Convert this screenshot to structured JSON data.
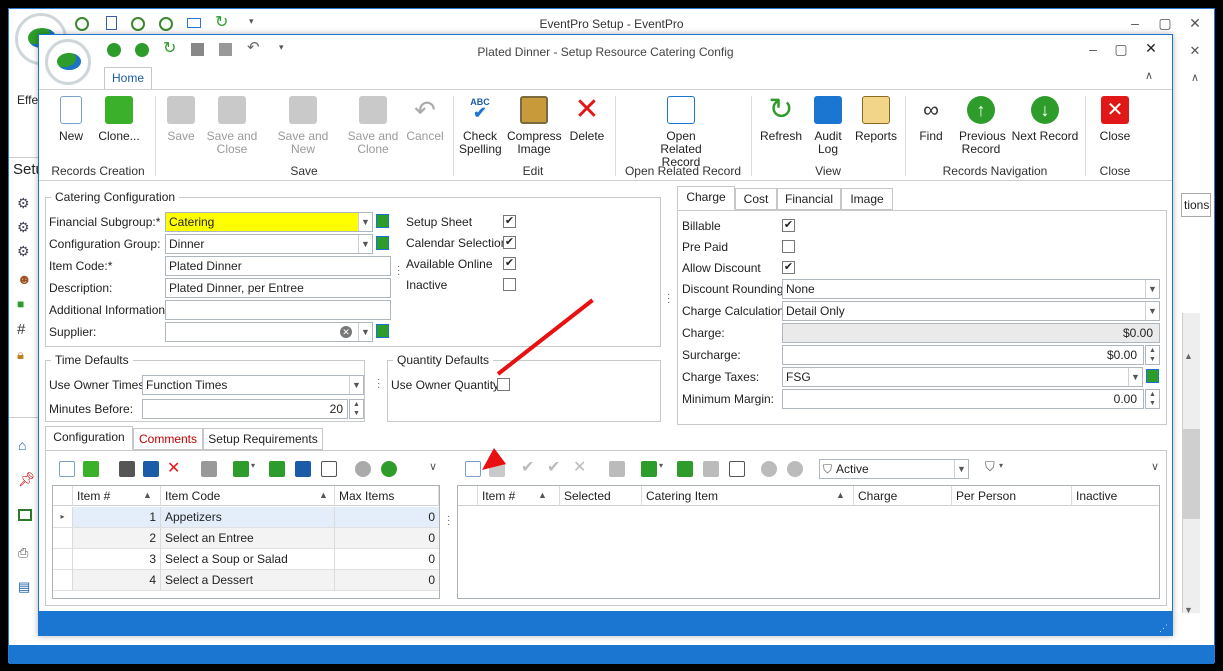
{
  "outer": {
    "title": "EventPro Setup - EventPro",
    "side_labels": [
      "Effe",
      "Setu"
    ],
    "right_tab_label": "tions"
  },
  "window": {
    "title": "Plated Dinner - Setup Resource Catering Config",
    "tab_home": "Home"
  },
  "ribbon": {
    "groups": {
      "records_creation": "Records Creation",
      "save": "Save",
      "edit": "Edit",
      "open_related": "Open Related Record",
      "view": "View",
      "nav": "Records Navigation",
      "close": "Close"
    },
    "buttons": {
      "new": "New",
      "clone": "Clone...",
      "save": "Save",
      "save_close": "Save and Close",
      "save_new": "Save and New",
      "save_clone": "Save and Clone",
      "cancel": "Cancel",
      "check_spelling": "Check Spelling",
      "compress_image": "Compress Image",
      "delete": "Delete",
      "open_related": "Open Related Record",
      "refresh": "Refresh",
      "audit_log": "Audit Log",
      "reports": "Reports",
      "find": "Find",
      "previous_record": "Previous Record",
      "next_record": "Next Record",
      "close": "Close"
    }
  },
  "catering_config": {
    "title": "Catering Configuration",
    "financial_subgroup_label": "Financial Subgroup:*",
    "financial_subgroup_value": "Catering",
    "config_group_label": "Configuration Group:",
    "config_group_value": "Dinner",
    "item_code_label": "Item Code:*",
    "item_code_value": "Plated Dinner",
    "description_label": "Description:",
    "description_value": "Plated Dinner, per Entree",
    "additional_info_label": "Additional Information:",
    "additional_info_value": "",
    "supplier_label": "Supplier:",
    "supplier_value": "",
    "setup_sheet_label": "Setup Sheet",
    "setup_sheet_checked": true,
    "calendar_selection_label": "Calendar Selection",
    "calendar_selection_checked": true,
    "available_online_label": "Available Online",
    "available_online_checked": true,
    "inactive_label": "Inactive",
    "inactive_checked": false
  },
  "time_defaults": {
    "title": "Time Defaults",
    "use_owner_times_label": "Use Owner Times:",
    "use_owner_times_value": "Function Times",
    "minutes_before_label": "Minutes Before:",
    "minutes_before_value": "20"
  },
  "quantity_defaults": {
    "title": "Quantity Defaults",
    "use_owner_quantity_label": "Use Owner Quantity",
    "use_owner_quantity_checked": false
  },
  "charge_panel": {
    "tabs": [
      "Charge",
      "Cost",
      "Financial",
      "Image"
    ],
    "billable_label": "Billable",
    "billable_checked": true,
    "pre_paid_label": "Pre Paid",
    "pre_paid_checked": false,
    "allow_discount_label": "Allow Discount",
    "allow_discount_checked": true,
    "discount_rounding_label": "Discount Rounding:",
    "discount_rounding_value": "None",
    "charge_calc_label": "Charge Calculation:",
    "charge_calc_value": "Detail Only",
    "charge_label": "Charge:",
    "charge_value": "$0.00",
    "surcharge_label": "Surcharge:",
    "surcharge_value": "$0.00",
    "charge_taxes_label": "Charge Taxes:",
    "charge_taxes_value": "FSG",
    "min_margin_label": "Minimum Margin:",
    "min_margin_value": "0.00"
  },
  "bottom_tabs": [
    "Configuration",
    "Comments",
    "Setup Requirements"
  ],
  "left_grid": {
    "columns": [
      "Item #",
      "Item Code",
      "Max Items"
    ],
    "rows": [
      {
        "num": "1",
        "code": "Appetizers",
        "max": "0"
      },
      {
        "num": "2",
        "code": "Select an Entree",
        "max": "0"
      },
      {
        "num": "3",
        "code": "Select a Soup or Salad",
        "max": "0"
      },
      {
        "num": "4",
        "code": "Select a Dessert",
        "max": "0"
      }
    ]
  },
  "right_grid": {
    "filter_value": "Active",
    "columns": [
      "Item #",
      "Selected",
      "Catering Item",
      "Charge",
      "Per Person",
      "Inactive"
    ]
  },
  "colors": {
    "accent": "#1b76d2",
    "required_highlight": "#ffff00",
    "comments_tab": "#c00000",
    "annotation_arrow": "#e81010"
  }
}
